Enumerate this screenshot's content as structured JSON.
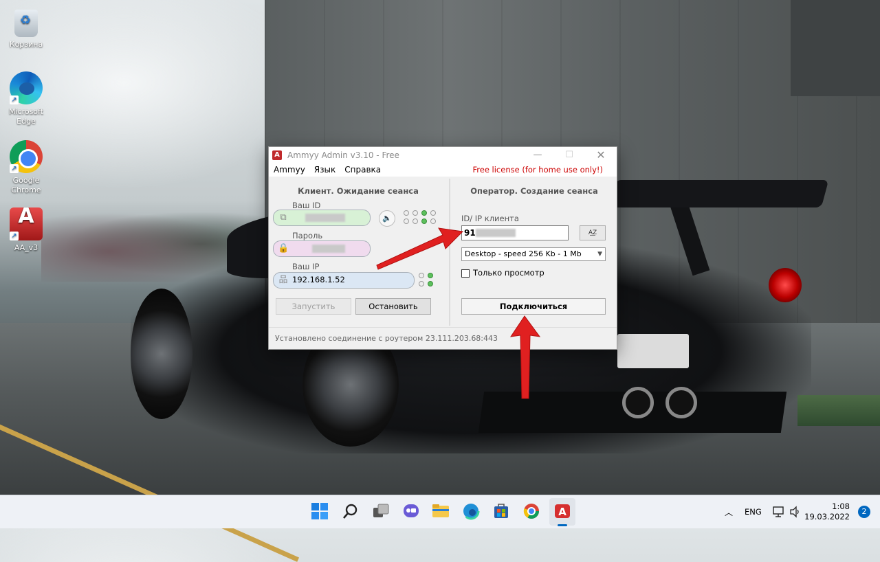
{
  "desktop": {
    "icons": [
      {
        "label": "Корзина",
        "icon": "recycle-bin-icon"
      },
      {
        "label": "Microsoft Edge",
        "icon": "edge-icon"
      },
      {
        "label": "Google Chrome",
        "icon": "chrome-icon"
      },
      {
        "label": "AA_v3",
        "icon": "ammyy-admin-icon"
      }
    ]
  },
  "window": {
    "title": "Ammyy Admin v3.10 - Free",
    "menu": [
      "Ammyy",
      "Язык",
      "Справка"
    ],
    "license": "Free license (for home use only!)",
    "client": {
      "title": "Клиент. Ожидание сеанса",
      "id_label": "Ваш ID",
      "password_label": "Пароль",
      "ip_label": "Ваш IP",
      "ip_value": "192.168.1.52",
      "start_label": "Запустить",
      "stop_label": "Остановить"
    },
    "operator": {
      "title": "Оператор. Создание сеанса",
      "client_id_label": "ID/ IP клиента",
      "client_id_value": "91",
      "speed_selected": "Desktop - speed  256 Kb - 1 Mb",
      "view_only_label": "Только просмотр",
      "view_only_checked": false,
      "connect_label": "Подключиться"
    },
    "status": "Установлено соединение с роутером 23.111.203.68:443"
  },
  "taskbar": {
    "language": "ENG",
    "time": "1:08",
    "date": "19.03.2022",
    "notifications": "2"
  },
  "colors": {
    "annotation_arrow": "#e02020",
    "license_text": "#cc0000",
    "accent": "#0067c0"
  }
}
